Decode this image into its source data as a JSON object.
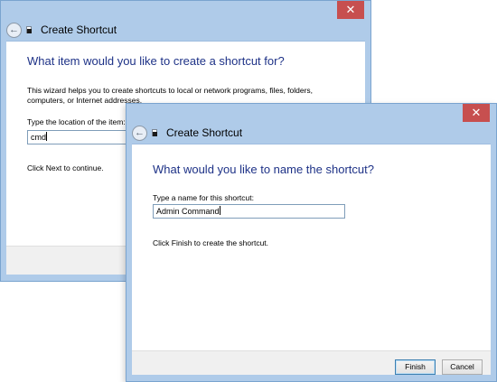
{
  "back_window": {
    "title": "Create Shortcut",
    "close_glyph": "✕",
    "heading": "What item would you like to create a shortcut for?",
    "description": "This wizard helps you to create shortcuts to local or network programs, files, folders, computers, or Internet addresses.",
    "location_label": "Type the location of the item:",
    "location_value": "cmd",
    "hint": "Click Next to continue."
  },
  "front_window": {
    "title": "Create Shortcut",
    "close_glyph": "✕",
    "heading": "What would you like to name the shortcut?",
    "name_label": "Type a name for this shortcut:",
    "name_value": "Admin Command",
    "hint": "Click Finish to create the shortcut.",
    "finish_label": "Finish",
    "cancel_label": "Cancel"
  },
  "icons": {
    "back": "back-arrow-icon",
    "close": "close-icon",
    "shortcut": "shortcut-icon"
  },
  "colors": {
    "window_frame": "#afcbe9",
    "heading_text": "#1e3287",
    "close_button": "#c74f4f"
  }
}
